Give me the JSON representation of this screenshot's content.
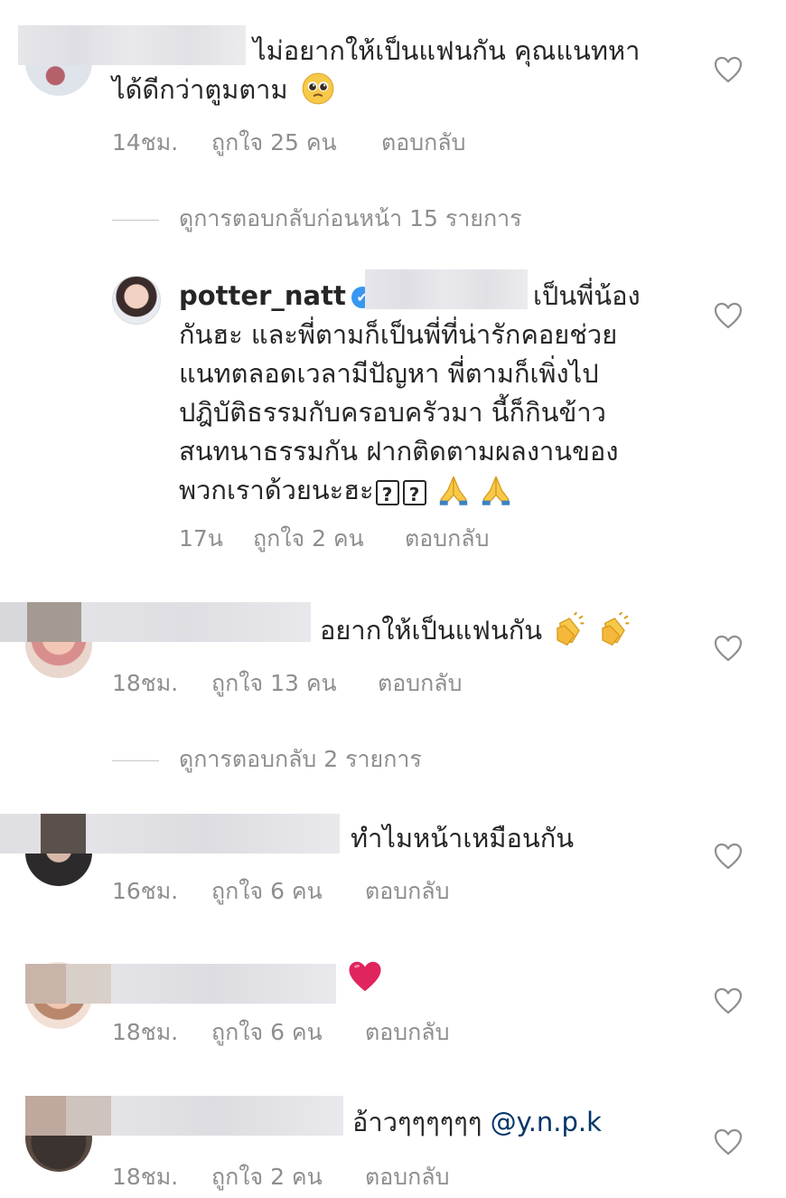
{
  "comments": [
    {
      "text_line1": "ไม่อยากให้เป็นแฟนกัน คุณแนทหา",
      "text_line2": "ได้ดีกว่าตูมตาม",
      "time": "14ชม.",
      "likes": "ถูกใจ 25 คน",
      "reply": "ตอบกลับ",
      "view_replies": "ดูการตอบกลับก่อนหน้า 15 รายการ",
      "emoji_icon": "pleading-face-icon"
    },
    {
      "text": "อยากให้เป็นแฟนกัน",
      "time": "18ชม.",
      "likes": "ถูกใจ 13 คน",
      "reply": "ตอบกลับ",
      "view_replies": "ดูการตอบกลับ 2 รายการ",
      "emoji_icon": "clapping-hands-icon"
    },
    {
      "text": "ทำไมหน้าเหมือนกัน",
      "time": "16ชม.",
      "likes": "ถูกใจ 6 คน",
      "reply": "ตอบกลับ"
    },
    {
      "text": "",
      "time": "18ชม.",
      "likes": "ถูกใจ 6 คน",
      "reply": "ตอบกลับ",
      "emoji_icon": "red-heart-icon"
    },
    {
      "text": "อ้าวๆๆๆๆๆๆ",
      "mention": "@y.n.p.k",
      "time": "18ชม.",
      "likes": "ถูกใจ 2 คน",
      "reply": "ตอบกลับ"
    }
  ],
  "reply": {
    "username": "potter_natt",
    "line1": "เป็นพี่น้อง",
    "line2": "กันฮะ และพี่ตามก็เป็นพี่ที่น่ารักคอยช่วย",
    "line3": "แนทตลอดเวลามีปัญหา พี่ตามก็เพิ่งไป",
    "line4": "ปฎิบัติธรรมกับครอบครัวมา นี้ก็กินข้าว",
    "line5": "สนทนาธรรมกัน ฝากติดตามผลงานของ",
    "line6": "พวกเราด้วยนะฮะ",
    "qmark": "?",
    "time": "17น",
    "likes": "ถูกใจ 2 คน",
    "reply_label": "ตอบกลับ",
    "verified_mark": "✔",
    "emoji_icon": "folded-hands-icon"
  },
  "colors": {
    "text": "#262626",
    "meta": "#8e8e8e",
    "mention": "#003569",
    "verified": "#3897f0",
    "heart_emoji": "#e0245e"
  }
}
